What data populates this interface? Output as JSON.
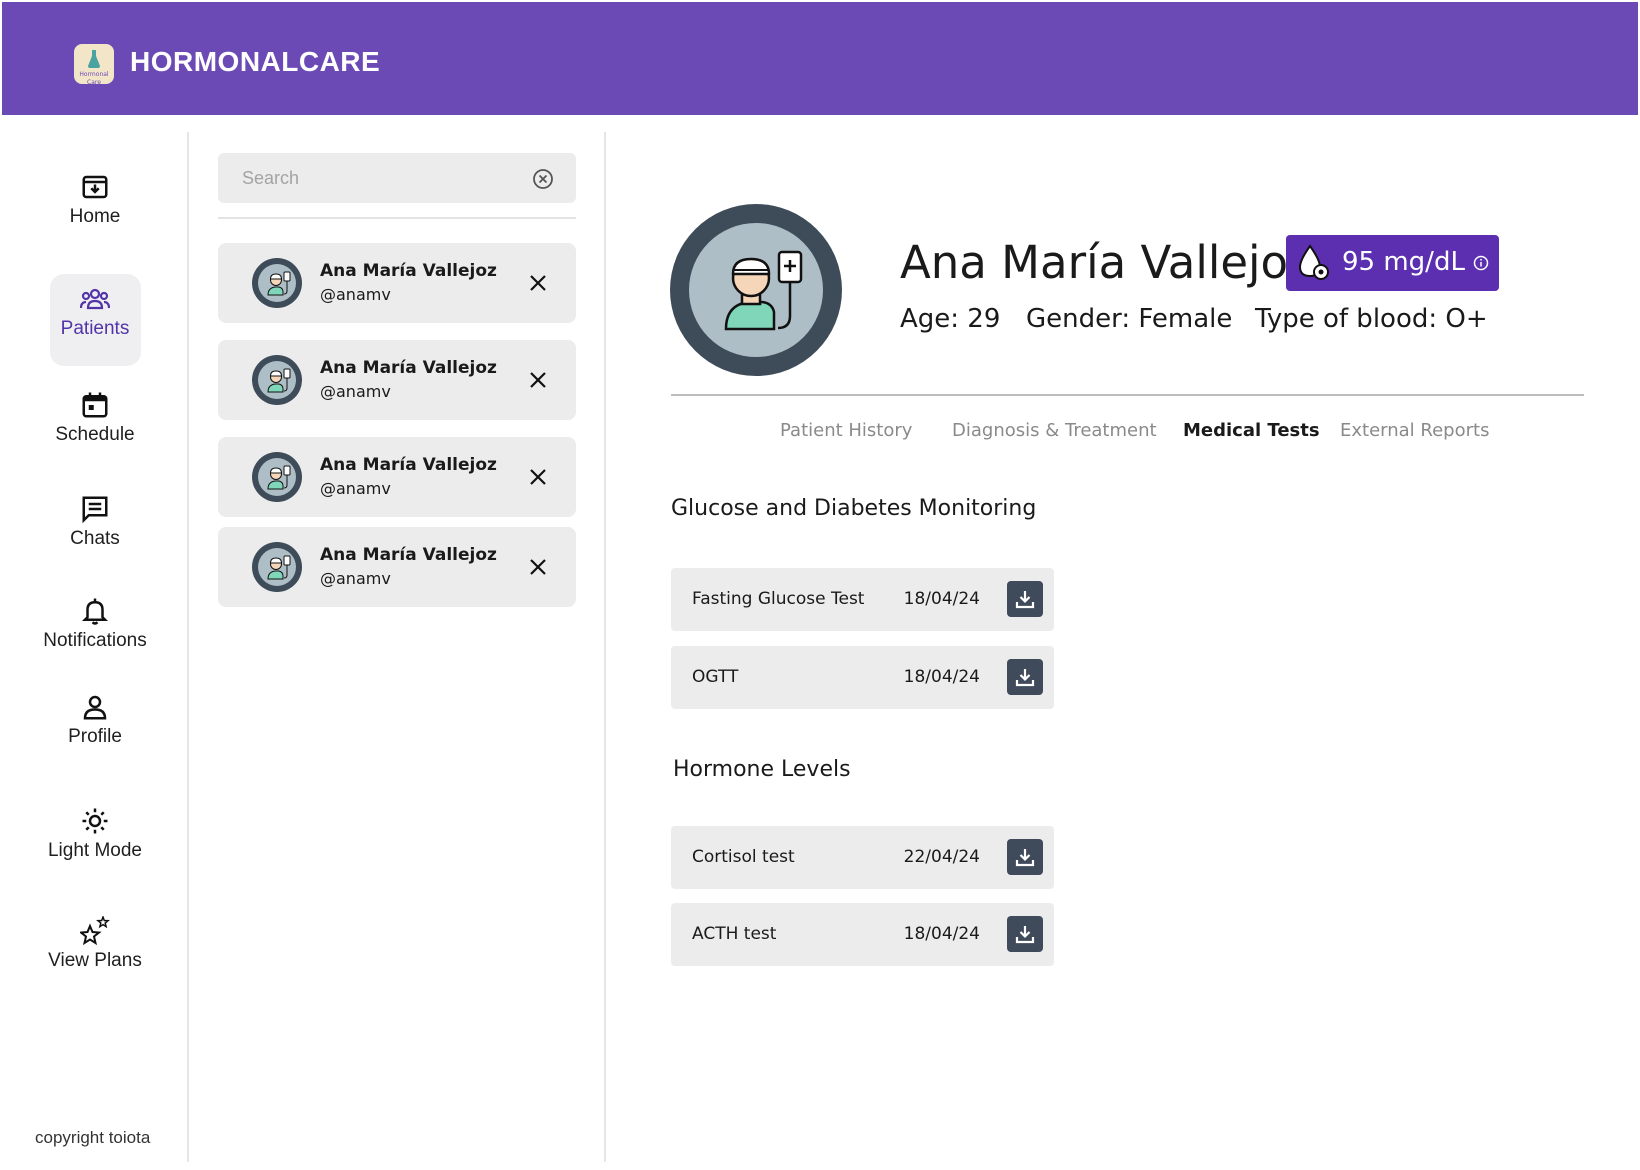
{
  "app": {
    "title": "HORMONALCARE",
    "logo_text": "Hormonal Care"
  },
  "nav": {
    "items": [
      {
        "label": "Home",
        "icon": "home-icon"
      },
      {
        "label": "Patients",
        "icon": "patients-icon",
        "active": true
      },
      {
        "label": "Schedule",
        "icon": "calendar-icon"
      },
      {
        "label": "Chats",
        "icon": "chat-icon"
      },
      {
        "label": "Notifications",
        "icon": "bell-icon"
      },
      {
        "label": "Profile",
        "icon": "person-icon"
      },
      {
        "label": "Light Mode",
        "icon": "sun-icon"
      },
      {
        "label": "View Plans",
        "icon": "stars-icon"
      }
    ],
    "copyright": "copyright toiota"
  },
  "search": {
    "placeholder": "Search",
    "value": ""
  },
  "patients": [
    {
      "name": "Ana María Vallejoz",
      "username": "@anamv"
    },
    {
      "name": "Ana María Vallejoz",
      "username": "@anamv"
    },
    {
      "name": "Ana María Vallejoz",
      "username": "@anamv"
    },
    {
      "name": "Ana María Vallejoz",
      "username": "@anamv"
    }
  ],
  "profile": {
    "name": "Ana María Vallejoz",
    "glucose": "95 mg/dL",
    "age": "Age: 29",
    "gender": "Gender: Female",
    "blood": "Type of blood: O+"
  },
  "tabs": [
    {
      "label": "Patient History",
      "active": false
    },
    {
      "label": "Diagnosis & Treatment",
      "active": false
    },
    {
      "label": "Medical Tests",
      "active": true
    },
    {
      "label": "External Reports",
      "active": false
    }
  ],
  "sections": [
    {
      "title": "Glucose and Diabetes Monitoring",
      "tests": [
        {
          "name": "Fasting Glucose Test",
          "date": "18/04/24"
        },
        {
          "name": "OGTT",
          "date": "18/04/24"
        }
      ]
    },
    {
      "title": "Hormone Levels",
      "tests": [
        {
          "name": "Cortisol test",
          "date": "22/04/24"
        },
        {
          "name": "ACTH test",
          "date": "18/04/24"
        }
      ]
    }
  ],
  "colors": {
    "primary": "#6c4ab6",
    "badge": "#5b2fb0",
    "active_nav_text": "#5234a8",
    "card_bg": "#ececec",
    "download_button": "#3f4a5a"
  }
}
